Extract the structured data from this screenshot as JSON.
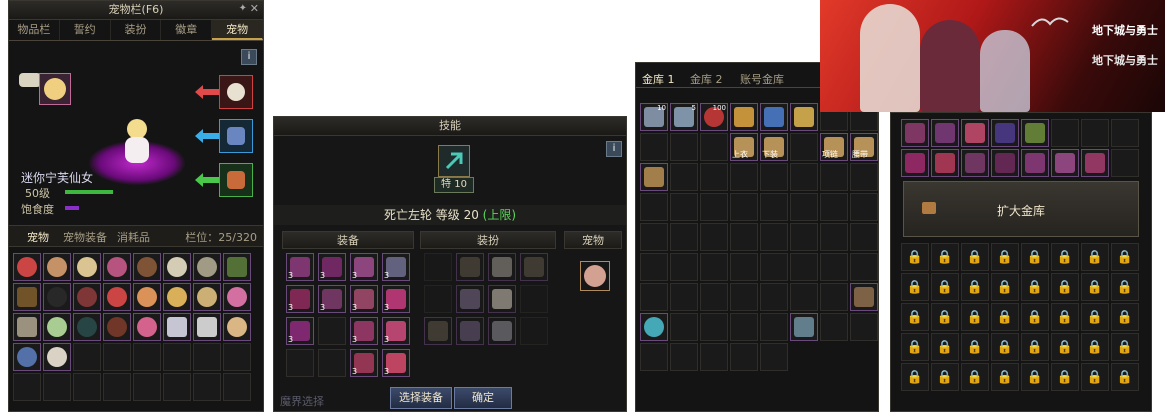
{
  "pet_window": {
    "title": "宠物栏(F6)",
    "tabs": [
      "物品栏",
      "誓约",
      "装扮",
      "徽章",
      "宠物"
    ],
    "active_tab": "宠物",
    "info_label": "i",
    "pet_name": "迷你宁芙仙女",
    "level_label": "50级",
    "satiety_label": "饱食度",
    "sub_tabs": [
      "宠物",
      "宠物装备",
      "消耗品"
    ],
    "slot_count": "栏位：25/320",
    "colors": {
      "level_bar": "#3fb83f",
      "satiety_bar": "#8a2fc8",
      "accent": "#c8a24a"
    }
  },
  "skill_window": {
    "title": "技能",
    "info_label": "i",
    "skill_label": "特 10",
    "skill_desc": "死亡左轮 等级 20",
    "skill_limit": "(上限)",
    "sections": [
      "装备",
      "装扮",
      "宠物"
    ],
    "buttons": {
      "select_equip": "选择装备",
      "confirm": "确定"
    },
    "footer_faded": "魔界选择"
  },
  "vault_window": {
    "tabs": [
      "金库 1",
      "金库 2",
      "账号金库"
    ],
    "active_tab": "金库 1",
    "item_counts": [
      "10",
      "5",
      "100"
    ],
    "item_tags": [
      "上衣",
      "下装",
      "项链",
      "腰带"
    ]
  },
  "vault2_window": {
    "expand_label": "扩大金库"
  },
  "banner": {
    "logo_text": [
      "地下城与勇士",
      "地下城与勇士"
    ]
  }
}
